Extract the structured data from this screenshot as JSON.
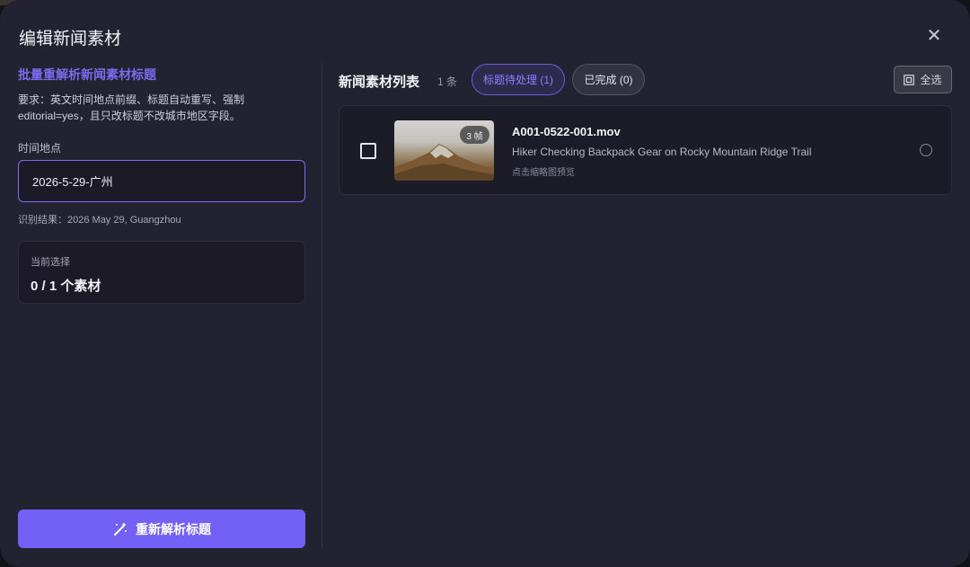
{
  "dialog": {
    "title": "编辑新闻素材",
    "close_label": "✕"
  },
  "left": {
    "section_title": "批量重解析新闻素材标题",
    "requirement": "要求：英文时间地点前缀、标题自动重写、强制 editorial=yes，且只改标题不改城市地区字段。",
    "field_label": "时间地点",
    "field_value": "2026-5-29-广州",
    "parse_result": "识别结果：2026 May 29, Guangzhou",
    "selection_label": "当前选择",
    "selection_count": "0 / 1 个素材",
    "reparse_button": "重新解析标题"
  },
  "right": {
    "list_title": "新闻素材列表",
    "list_count": "1 条",
    "tabs": [
      {
        "label": "标题待处理 (1)",
        "active": true
      },
      {
        "label": "已完成 (0)",
        "active": false
      }
    ],
    "select_all": "全选",
    "items": [
      {
        "frames": "3 帧",
        "file_name": "A001-0522-001.mov",
        "title": "Hiker Checking Backpack Gear on Rocky Mountain Ridge Trail",
        "hint": "点击缩略图预览",
        "checked": false
      }
    ]
  },
  "colors": {
    "accent": "#7361f5",
    "dialog_bg": "#232231",
    "card_bg": "#1c1b28"
  }
}
